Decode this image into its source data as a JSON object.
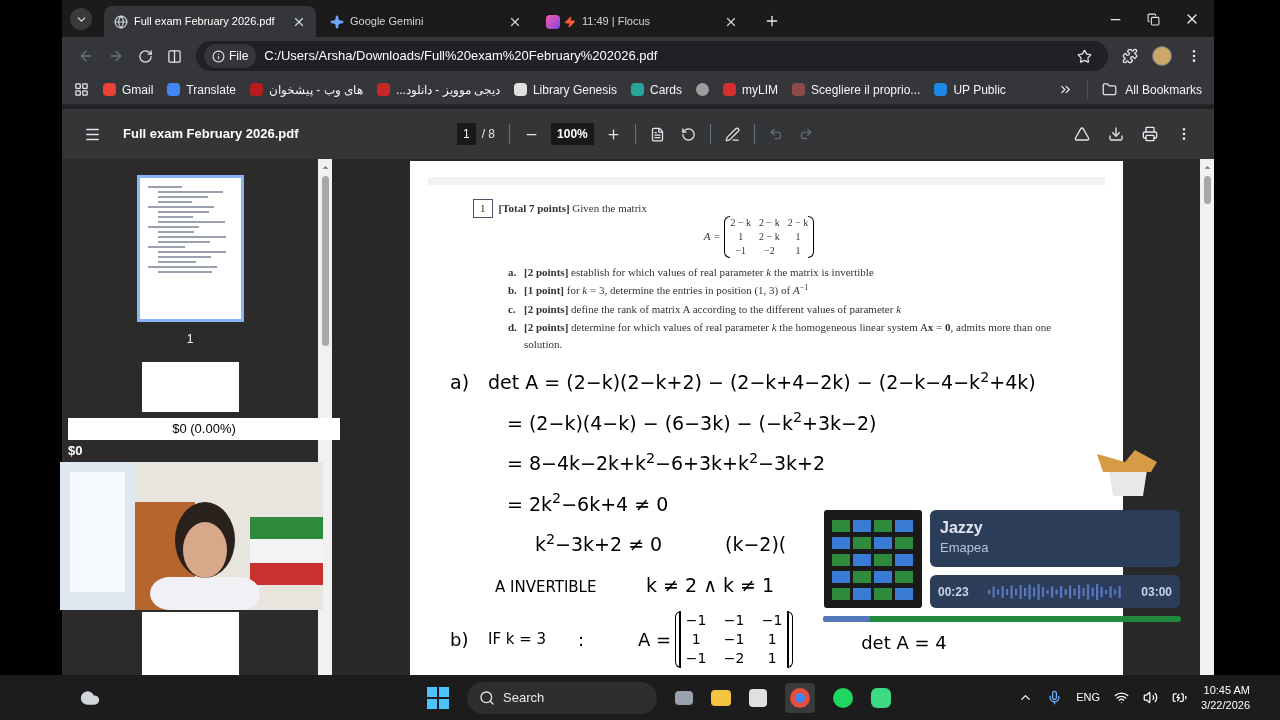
{
  "tabs": [
    {
      "title": "Full exam February 2026.pdf",
      "selected": true
    },
    {
      "title": "Google Gemini",
      "selected": false
    },
    {
      "title": "11:49 | Flocus",
      "selected": false
    }
  ],
  "address": {
    "scheme": "File",
    "url": "C:/Users/Arsha/Downloads/Full%20exam%20February%202026.pdf"
  },
  "bookmarks": [
    {
      "label": "Gmail",
      "color": "#ea4335"
    },
    {
      "label": "Translate",
      "color": "#4285f4"
    },
    {
      "label": "های وب - پیشخوان",
      "color": "#b71c1c"
    },
    {
      "label": "دیجی موویز - دانلود...",
      "color": "#c62828"
    },
    {
      "label": "Library Genesis",
      "color": "#e0e0e0"
    },
    {
      "label": "Cards",
      "color": "#26a69a"
    },
    {
      "color": "#9e9e9e"
    },
    {
      "label": "myLIM",
      "color": "#d32f2f"
    },
    {
      "label": "Scegliere il proprio...",
      "color": "#8d4a4a"
    },
    {
      "label": "UP Public",
      "color": "#1e88e5"
    }
  ],
  "all_bookmarks": "All Bookmarks",
  "pdf": {
    "title": "Full exam February 2026.pdf",
    "page": "1",
    "page_count": "/ 8",
    "zoom": "100%"
  },
  "thumbnails": [
    {
      "label": "1",
      "selected": true
    },
    {
      "selected": false
    },
    {
      "selected": false
    }
  ],
  "question": {
    "number": "1",
    "heading": "**[Total 7 points]** Given the matrix",
    "matrix_label": "A =",
    "matrix": [
      [
        "2 − k",
        "2 − k",
        "2 − k"
      ],
      [
        "1",
        "2 − k",
        "1"
      ],
      [
        "−1",
        "−2",
        "1"
      ]
    ],
    "parts": [
      {
        "letter": "a.",
        "text": "**[2 points]** establish for which values of real parameter *k* the matrix is invertible"
      },
      {
        "letter": "b.",
        "text": "**[1 point]** for *k* = 3, determine the entries in position (1, 3) of *A*$^{−1}$"
      },
      {
        "letter": "c.",
        "text": "**[2 points]** define the rank of matrix A according to the different values of parameter *k*"
      },
      {
        "letter": "d.",
        "text": "**[2 points]** determine for which values of real parameter *k* the homogeneous linear system A**x** = **0**, admits more than one solution."
      }
    ]
  },
  "handwriting": [
    {
      "kind": "start",
      "label": "a)",
      "text": "det A = (2−k)(2−k+2) − (2−k+4−2k) − (2−k−4−k$^{2}$+4k)"
    },
    {
      "kind": "step",
      "text": "= (2−k)(4−k) − (6−3k) − (−k$^{2}$+3k−2)"
    },
    {
      "kind": "step",
      "text": "= 8−4k−2k+k$^{2}$−6+3k+k$^{2}$−3k+2"
    },
    {
      "kind": "step",
      "text": "= 2k$^{2}$−6k+4 ≠ 0"
    },
    {
      "kind": "sub",
      "text": "k$^{2}$−3k+2 ≠ 0",
      "aside": "(k−2)("
    },
    {
      "kind": "note",
      "text": "A INVERTIBLE",
      "aside": "k ≠ 2 ∧ k ≠ 1"
    }
  ],
  "part_b": {
    "label": "b)",
    "condition": "IF k = 3",
    "colon": ":",
    "matrix_label": "A =",
    "matrix": [
      [
        "−1",
        "−1",
        "−1"
      ],
      [
        "1",
        "−1",
        "1"
      ],
      [
        "−1",
        "−2",
        "1"
      ]
    ],
    "result": "det A = 4"
  },
  "overlay": {
    "amount": "$0 (0.00%)",
    "start": "$0"
  },
  "player": {
    "title": "Jazzy",
    "artist": "Emapea",
    "elapsed": "00:23",
    "total": "03:00",
    "level": 0.13
  },
  "taskbar": {
    "search": "Search",
    "language": "ENG",
    "time": "10:45 AM",
    "date": "3/22/2026"
  }
}
